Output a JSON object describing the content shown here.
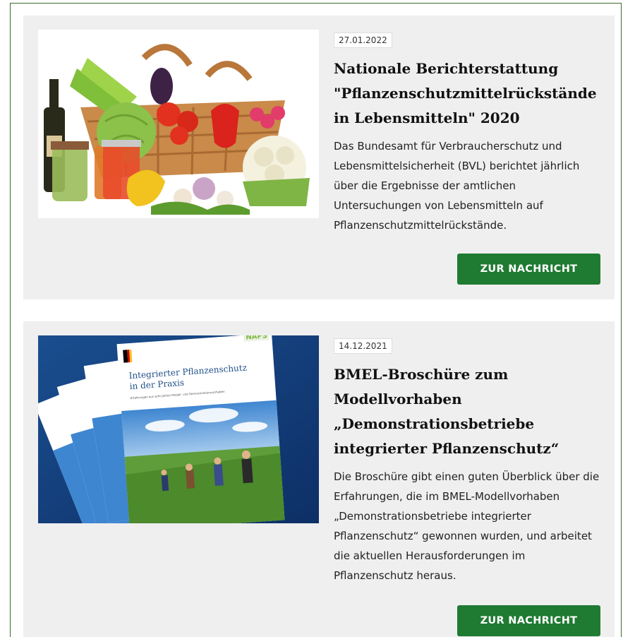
{
  "news": [
    {
      "date": "27.01.2022",
      "title": "Nationale Berichterstattung \"Pflanzenschutzmittelrückstände in Lebensmitteln\" 2020",
      "text": "Das Bundesamt für Verbraucherschutz und Lebensmittelsicherheit (BVL) berichtet jährlich über die Ergebnisse der amtlichen Untersuchungen von Lebensmitteln auf Pflanzenschutzmittelrückstände.",
      "button": "ZUR NACHRICHT"
    },
    {
      "date": "14.12.2021",
      "title": "BMEL-Broschüre zum Modellvorhaben „Demonstrationsbetriebe integrierter Pflanzenschutz“",
      "text": "Die Broschüre gibt einen guten Überblick über die Erfahrungen, die im BMEL-Modellvorhaben „Demonstrationsbetriebe integrierter Pflanzenschutz“ gewonnen wurden, und arbeitet die aktuellen Herausforderungen im Pflanzenschutz heraus.",
      "button": "ZUR NACHRICHT",
      "image_text": {
        "brochure_title": "Integrierter Pflanzenschutz in der Praxis",
        "brochure_subtitle": "Erfahrungen aus acht Jahren Modell- und Demonstrationsvorhaben „Demonstrationsbetriebe integrierter Pflanzenschutz“",
        "logo": "NAPS"
      }
    }
  ]
}
